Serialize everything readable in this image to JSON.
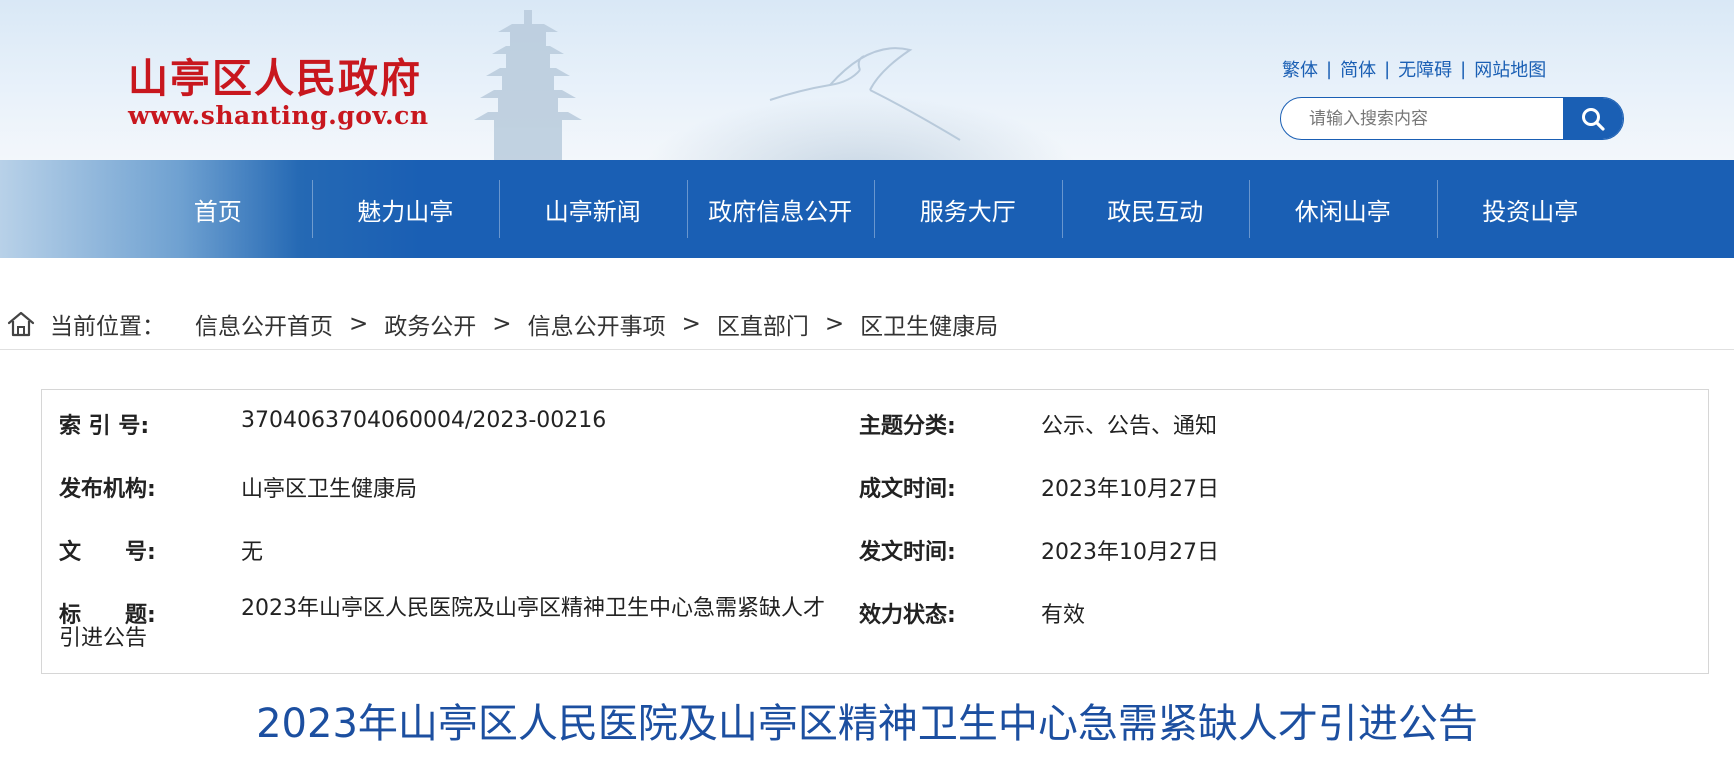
{
  "header": {
    "site_name": "山亭区人民政府",
    "site_url": "www.shanting.gov.cn",
    "links": [
      "繁体",
      "简体",
      "无障碍",
      "网站地图"
    ],
    "search": {
      "placeholder": "请输入搜索内容"
    },
    "colors": {
      "brand_red": "#c8171e",
      "accent_blue": "#1a5fb4"
    }
  },
  "nav": {
    "items": [
      "首页",
      "魅力山亭",
      "山亭新闻",
      "政府信息公开",
      "服务大厅",
      "政民互动",
      "休闲山亭",
      "投资山亭"
    ]
  },
  "breadcrumb": {
    "label": "当前位置：",
    "items": [
      "信息公开首页",
      "政务公开",
      "信息公开事项",
      "区直部门",
      "区卫生健康局"
    ],
    "separator": ">"
  },
  "meta": {
    "index_label": "索 引 号:",
    "index_value": "3704063704060004/2023-00216",
    "topic_label": "主题分类:",
    "topic_value": "公示、公告、通知",
    "org_label": "发布机构:",
    "org_value": "山亭区卫生健康局",
    "created_label": "成文时间:",
    "created_value": "2023年10月27日",
    "docno_label": "文　　号:",
    "docno_value": "无",
    "published_label": "发文时间:",
    "published_value": "2023年10月27日",
    "title_label": "标　　题:",
    "title_value": "2023年山亭区人民医院及山亭区精神卫生中心急需紧缺人才引进公告",
    "status_label": "效力状态:",
    "status_value": "有效"
  },
  "article": {
    "title": "2023年山亭区人民医院及山亭区精神卫生中心急需紧缺人才引进公告"
  }
}
